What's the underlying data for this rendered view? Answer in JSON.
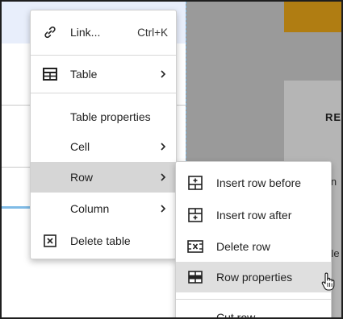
{
  "background": {
    "heading_fragment": "RE",
    "cell_fragments": [
      "in",
      "Ne"
    ]
  },
  "context_menu": {
    "items": [
      {
        "label": "Link...",
        "shortcut": "Ctrl+K",
        "icon": "link-icon"
      },
      {
        "label": "Table",
        "icon": "table-icon",
        "has_submenu": true
      },
      {
        "label": "Table properties"
      },
      {
        "label": "Cell",
        "has_submenu": true
      },
      {
        "label": "Row",
        "has_submenu": true,
        "highlighted": true
      },
      {
        "label": "Column",
        "has_submenu": true
      },
      {
        "label": "Delete table",
        "icon": "delete-table-icon"
      }
    ]
  },
  "row_submenu": {
    "items": [
      {
        "label": "Insert row before",
        "icon": "insert-row-before-icon"
      },
      {
        "label": "Insert row after",
        "icon": "insert-row-after-icon"
      },
      {
        "label": "Delete row",
        "icon": "delete-row-icon"
      },
      {
        "label": "Row properties",
        "icon": "row-properties-icon",
        "highlighted": true
      },
      {
        "label": "Cut row"
      }
    ]
  },
  "colors": {
    "highlight": "#d6d6d6",
    "selection_blue": "#7fbbe6",
    "header_accent": "#b07d12"
  }
}
